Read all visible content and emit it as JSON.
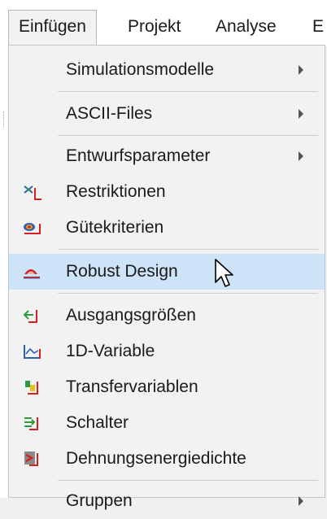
{
  "menubar": {
    "items": [
      {
        "label": "Einfügen"
      },
      {
        "label": "Projekt"
      },
      {
        "label": "Analyse"
      },
      {
        "label": "E"
      }
    ]
  },
  "menu": {
    "items": [
      {
        "label": "Simulationsmodelle",
        "submenu": true,
        "icon": "none"
      },
      {
        "label": "ASCII-Files",
        "submenu": true,
        "icon": "none"
      },
      {
        "label": "Entwurfsparameter",
        "submenu": true,
        "icon": "none"
      },
      {
        "label": "Restriktionen",
        "submenu": false,
        "icon": "restriction-icon"
      },
      {
        "label": "Gütekriterien",
        "submenu": false,
        "icon": "quality-criteria-icon"
      },
      {
        "label": "Robust Design",
        "submenu": false,
        "icon": "robust-design-icon"
      },
      {
        "label": "Ausgangsgrößen",
        "submenu": false,
        "icon": "output-variables-icon"
      },
      {
        "label": "1D-Variable",
        "submenu": false,
        "icon": "1d-variable-icon"
      },
      {
        "label": "Transfervariablen",
        "submenu": false,
        "icon": "transfer-variables-icon"
      },
      {
        "label": "Schalter",
        "submenu": false,
        "icon": "switch-icon"
      },
      {
        "label": "Dehnungsenergiedichte",
        "submenu": false,
        "icon": "strain-energy-density-icon"
      },
      {
        "label": "Gruppen",
        "submenu": true,
        "icon": "none"
      }
    ],
    "highlighted_index": 5
  },
  "colors": {
    "menu_bg": "#f2f2f2",
    "highlight_bg": "#cde3f7",
    "icon_red": "#d42020",
    "icon_blue": "#2b5fb6",
    "icon_green": "#2f9a3c"
  }
}
